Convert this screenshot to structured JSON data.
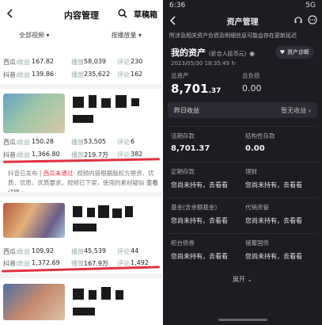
{
  "left": {
    "title": "内容管理",
    "drafts": "草稿箱",
    "filter_all": "全部视频",
    "filter_sort": "按播放量",
    "item1": {
      "xigua": {
        "platform": "西瓜:",
        "earn_label": "收益",
        "earn": "167.82",
        "play_label": "播放",
        "play": "58,039",
        "comment_label": "评论",
        "comment": "230"
      },
      "douyin": {
        "platform": "抖音:",
        "earn_label": "收益",
        "earn": "139.86",
        "play_label": "播放",
        "play": "235,622",
        "comment_label": "评论",
        "comment": "162"
      }
    },
    "item2": {
      "xigua": {
        "platform": "西瓜:",
        "earn_label": "收益",
        "earn": "150.28",
        "play_label": "播放",
        "play": "53,505",
        "comment_label": "评论",
        "comment": "6"
      },
      "douyin": {
        "platform": "抖音:",
        "earn_label": "收益",
        "earn": "1,366.80",
        "play_label": "播放",
        "play": "219.7万",
        "comment_label": "评论",
        "comment": "382"
      }
    },
    "notice_prefix": "抖音已发布",
    "notice_red": "西瓜未通过",
    "notice_rest": "· 视频内容根据版权方擦资、优质、优质、优质要求。视频已下架，使用的素材疑似",
    "notice_link": "查看详情",
    "item3": {
      "xigua": {
        "platform": "西瓜:",
        "earn_label": "收益",
        "earn": "109.92",
        "play_label": "播放",
        "play": "45,539",
        "comment_label": "评论",
        "comment": "44"
      },
      "douyin": {
        "platform": "抖音:",
        "earn_label": "收益",
        "earn": "1,372.69",
        "play_label": "播放",
        "play": "167.9万",
        "comment_label": "评论",
        "comment": "1,492"
      }
    }
  },
  "right": {
    "time": "6:36",
    "status_right": "5G",
    "title": "资产管理",
    "banner": "所涉及相关资产负债及明细信息可能会存在更新延迟",
    "my_assets": "我的资产",
    "currency": "(折合人民币元)",
    "diag": "资产诊断",
    "timestamp": "2023/05/30 18:35:49",
    "total_assets_label": "总资产",
    "total_assets_int": "8,701",
    "total_assets_dec": ".37",
    "total_debt_label": "总负债",
    "total_debt": "0.00",
    "yesterday": "昨日收益",
    "yesterday_right": "暂无收益",
    "cards": [
      {
        "left": {
          "name": "活期存款",
          "val": "8,701.37"
        },
        "right": {
          "name": "结构性存款",
          "val": "0.00"
        }
      },
      {
        "left": {
          "name": "定期存款",
          "cta": "您尚未持有，去看看"
        },
        "right": {
          "name": "理财",
          "cta": "您尚未持有，去看看"
        }
      },
      {
        "left": {
          "name": "基金(含余额基金)",
          "cta": "您尚未持有，去看看"
        },
        "right": {
          "name": "代销资管",
          "cta": "您尚未持有，去看看"
        }
      },
      {
        "left": {
          "name": "柜台债券",
          "cta": "您尚未持有，去看看"
        },
        "right": {
          "name": "储蓄国债",
          "cta": "您尚未持有，去看看"
        }
      }
    ],
    "expand": "展开"
  }
}
